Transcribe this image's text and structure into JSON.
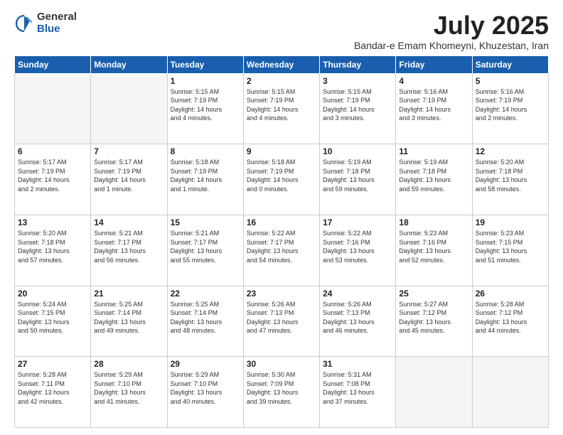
{
  "logo": {
    "general": "General",
    "blue": "Blue"
  },
  "title": {
    "month": "July 2025",
    "location": "Bandar-e Emam Khomeyni, Khuzestan, Iran"
  },
  "headers": [
    "Sunday",
    "Monday",
    "Tuesday",
    "Wednesday",
    "Thursday",
    "Friday",
    "Saturday"
  ],
  "weeks": [
    [
      {
        "day": "",
        "info": ""
      },
      {
        "day": "",
        "info": ""
      },
      {
        "day": "1",
        "info": "Sunrise: 5:15 AM\nSunset: 7:19 PM\nDaylight: 14 hours\nand 4 minutes."
      },
      {
        "day": "2",
        "info": "Sunrise: 5:15 AM\nSunset: 7:19 PM\nDaylight: 14 hours\nand 4 minutes."
      },
      {
        "day": "3",
        "info": "Sunrise: 5:15 AM\nSunset: 7:19 PM\nDaylight: 14 hours\nand 3 minutes."
      },
      {
        "day": "4",
        "info": "Sunrise: 5:16 AM\nSunset: 7:19 PM\nDaylight: 14 hours\nand 3 minutes."
      },
      {
        "day": "5",
        "info": "Sunrise: 5:16 AM\nSunset: 7:19 PM\nDaylight: 14 hours\nand 2 minutes."
      }
    ],
    [
      {
        "day": "6",
        "info": "Sunrise: 5:17 AM\nSunset: 7:19 PM\nDaylight: 14 hours\nand 2 minutes."
      },
      {
        "day": "7",
        "info": "Sunrise: 5:17 AM\nSunset: 7:19 PM\nDaylight: 14 hours\nand 1 minute."
      },
      {
        "day": "8",
        "info": "Sunrise: 5:18 AM\nSunset: 7:19 PM\nDaylight: 14 hours\nand 1 minute."
      },
      {
        "day": "9",
        "info": "Sunrise: 5:18 AM\nSunset: 7:19 PM\nDaylight: 14 hours\nand 0 minutes."
      },
      {
        "day": "10",
        "info": "Sunrise: 5:19 AM\nSunset: 7:18 PM\nDaylight: 13 hours\nand 59 minutes."
      },
      {
        "day": "11",
        "info": "Sunrise: 5:19 AM\nSunset: 7:18 PM\nDaylight: 13 hours\nand 59 minutes."
      },
      {
        "day": "12",
        "info": "Sunrise: 5:20 AM\nSunset: 7:18 PM\nDaylight: 13 hours\nand 58 minutes."
      }
    ],
    [
      {
        "day": "13",
        "info": "Sunrise: 5:20 AM\nSunset: 7:18 PM\nDaylight: 13 hours\nand 57 minutes."
      },
      {
        "day": "14",
        "info": "Sunrise: 5:21 AM\nSunset: 7:17 PM\nDaylight: 13 hours\nand 56 minutes."
      },
      {
        "day": "15",
        "info": "Sunrise: 5:21 AM\nSunset: 7:17 PM\nDaylight: 13 hours\nand 55 minutes."
      },
      {
        "day": "16",
        "info": "Sunrise: 5:22 AM\nSunset: 7:17 PM\nDaylight: 13 hours\nand 54 minutes."
      },
      {
        "day": "17",
        "info": "Sunrise: 5:22 AM\nSunset: 7:16 PM\nDaylight: 13 hours\nand 53 minutes."
      },
      {
        "day": "18",
        "info": "Sunrise: 5:23 AM\nSunset: 7:16 PM\nDaylight: 13 hours\nand 52 minutes."
      },
      {
        "day": "19",
        "info": "Sunrise: 5:23 AM\nSunset: 7:15 PM\nDaylight: 13 hours\nand 51 minutes."
      }
    ],
    [
      {
        "day": "20",
        "info": "Sunrise: 5:24 AM\nSunset: 7:15 PM\nDaylight: 13 hours\nand 50 minutes."
      },
      {
        "day": "21",
        "info": "Sunrise: 5:25 AM\nSunset: 7:14 PM\nDaylight: 13 hours\nand 49 minutes."
      },
      {
        "day": "22",
        "info": "Sunrise: 5:25 AM\nSunset: 7:14 PM\nDaylight: 13 hours\nand 48 minutes."
      },
      {
        "day": "23",
        "info": "Sunrise: 5:26 AM\nSunset: 7:13 PM\nDaylight: 13 hours\nand 47 minutes."
      },
      {
        "day": "24",
        "info": "Sunrise: 5:26 AM\nSunset: 7:13 PM\nDaylight: 13 hours\nand 46 minutes."
      },
      {
        "day": "25",
        "info": "Sunrise: 5:27 AM\nSunset: 7:12 PM\nDaylight: 13 hours\nand 45 minutes."
      },
      {
        "day": "26",
        "info": "Sunrise: 5:28 AM\nSunset: 7:12 PM\nDaylight: 13 hours\nand 44 minutes."
      }
    ],
    [
      {
        "day": "27",
        "info": "Sunrise: 5:28 AM\nSunset: 7:11 PM\nDaylight: 13 hours\nand 42 minutes."
      },
      {
        "day": "28",
        "info": "Sunrise: 5:29 AM\nSunset: 7:10 PM\nDaylight: 13 hours\nand 41 minutes."
      },
      {
        "day": "29",
        "info": "Sunrise: 5:29 AM\nSunset: 7:10 PM\nDaylight: 13 hours\nand 40 minutes."
      },
      {
        "day": "30",
        "info": "Sunrise: 5:30 AM\nSunset: 7:09 PM\nDaylight: 13 hours\nand 39 minutes."
      },
      {
        "day": "31",
        "info": "Sunrise: 5:31 AM\nSunset: 7:08 PM\nDaylight: 13 hours\nand 37 minutes."
      },
      {
        "day": "",
        "info": ""
      },
      {
        "day": "",
        "info": ""
      }
    ]
  ]
}
